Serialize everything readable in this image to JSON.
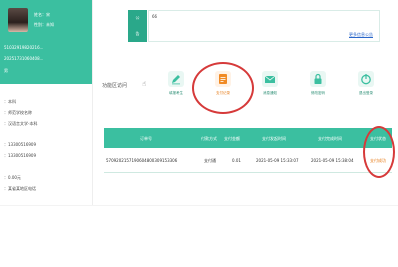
{
  "profile": {
    "name_label": "姓名：宋",
    "gender_label": "性别：未知",
    "id_number": "51032919820216...",
    "id_date": "20251731060408...",
    "extra": "男"
  },
  "sidebar_info": {
    "level": "：本科",
    "school": "：师范学校名称",
    "major": "：汉语言文学-本科",
    "phone1": "：13300516909",
    "phone2": "：13300516909",
    "amount": "：0.00元",
    "address": "：某省某地区电话"
  },
  "notice": {
    "label_top": "公",
    "label_bottom": "告",
    "text": "66",
    "more": "更多信息公告"
  },
  "shortcuts": {
    "section_title": "功能区访问",
    "items": [
      {
        "label": "填报考生",
        "icon": "edit-icon"
      },
      {
        "label": "支付记录",
        "icon": "payment-record-icon"
      },
      {
        "label": "消息通知",
        "icon": "mail-icon"
      },
      {
        "label": "修改密码",
        "icon": "lock-icon"
      },
      {
        "label": "退出登录",
        "icon": "logout-icon"
      }
    ]
  },
  "table": {
    "headers": [
      "订单号",
      "付款方式",
      "支付金额",
      "支付发起时间",
      "支付完成时间",
      "支付状态"
    ],
    "rows": [
      [
        "5709202157190604800309153306",
        "支付通",
        "0.01",
        "2021-05-09 15:33:07",
        "2021-05-09 15:38:04",
        "支付成功"
      ]
    ]
  },
  "colors": {
    "accent": "#3bbfa0",
    "annotation": "#d63a3a",
    "payment_icon": "#f08a24"
  }
}
